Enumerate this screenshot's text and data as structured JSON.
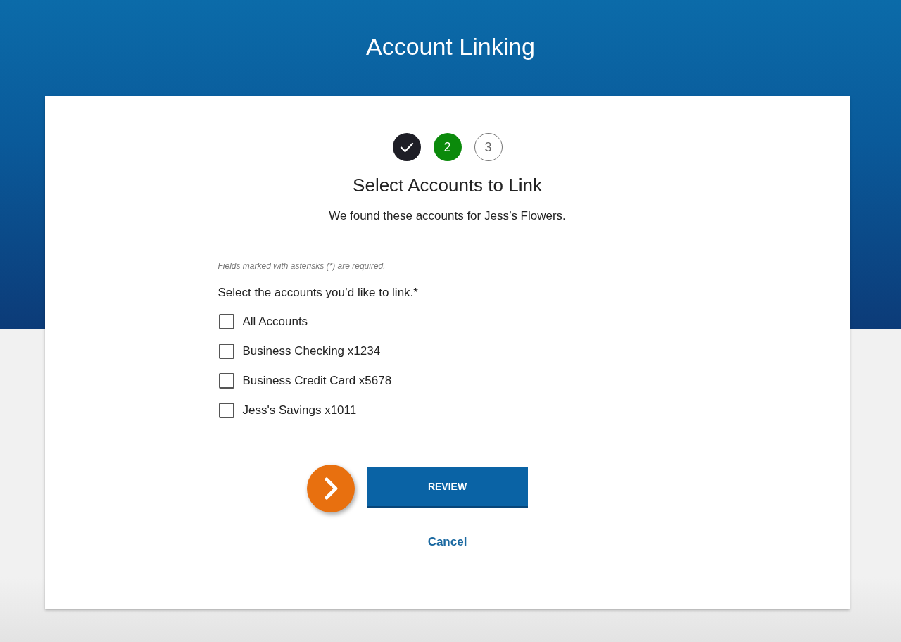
{
  "header": {
    "title": "Account Linking"
  },
  "steps": [
    {
      "kind": "completed"
    },
    {
      "kind": "current",
      "label": "2"
    },
    {
      "kind": "upcoming",
      "label": "3"
    }
  ],
  "heading": "Select Accounts to Link",
  "subtitle": "We found these accounts for Jess’s Flowers.",
  "form": {
    "note": "Fields marked with asterisks (*) are required.",
    "prompt": "Select the accounts you’d like to link.*",
    "accounts": [
      {
        "label": "All Accounts",
        "checked": false
      },
      {
        "label": "Business Checking x1234",
        "checked": false
      },
      {
        "label": "Business Credit Card x5678",
        "checked": false
      },
      {
        "label": "Jess's Savings x1011",
        "checked": false
      }
    ]
  },
  "review_button": "REVIEW",
  "cancel_link": "Cancel"
}
